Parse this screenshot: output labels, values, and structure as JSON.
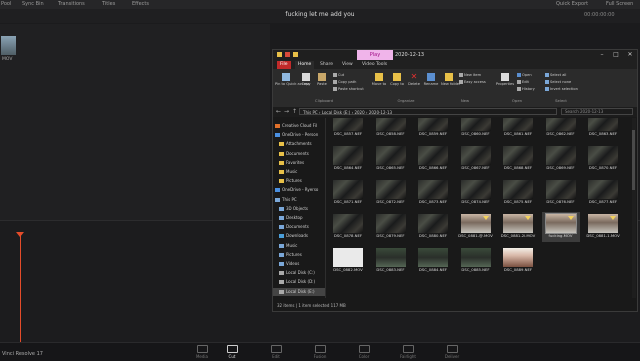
{
  "resolve": {
    "topbar": [
      "Pool",
      "Sync Bin",
      "Transitions",
      "Titles",
      "Effects"
    ],
    "quick_export": "Quick Export",
    "fullscreen": "Full Screen",
    "title": "fucking let me add you",
    "clip_label": "MOV",
    "version": "Vinci Resolve 17",
    "pages": [
      "Media",
      "Cut",
      "Edit",
      "Fusion",
      "Color",
      "Fairlight",
      "Deliver"
    ],
    "active_page": "Cut"
  },
  "explorer": {
    "play_tab": "Play",
    "title": "2020-12-13",
    "window_buttons": [
      "–",
      "□",
      "✕"
    ],
    "menu_tabs": [
      "File",
      "Home",
      "Share",
      "View",
      "Video Tools"
    ],
    "ribbon": {
      "pin": "Pin to Quick access",
      "copy": "Copy",
      "paste": "Paste",
      "cut": "Cut",
      "copy_path": "Copy path",
      "paste_shortcut": "Paste shortcut",
      "move_to": "Move to",
      "copy_to": "Copy to",
      "delete": "Delete",
      "rename": "Rename",
      "new_folder": "New folder",
      "new_item": "New item",
      "easy_access": "Easy access",
      "properties": "Properties",
      "open": "Open",
      "edit": "Edit",
      "history": "History",
      "select_all": "Select all",
      "select_none": "Select none",
      "invert_selection": "Invert selection",
      "groups": [
        "Clipboard",
        "Organize",
        "New",
        "Open",
        "Select"
      ]
    },
    "breadcrumb": [
      "This PC",
      "Local Disk (E:)",
      "2020",
      "2020-12-13"
    ],
    "search_placeholder": "Search 2020-12-13",
    "nav_items": [
      "Creative Cloud Fil",
      "OneDrive - Person",
      "Attachments",
      "Documents",
      "Favorites",
      "Music",
      "Pictures",
      "OneDrive - Ryerso",
      "This PC",
      "3D Objects",
      "Desktop",
      "Documents",
      "Downloads",
      "Music",
      "Pictures",
      "Videos",
      "Local Disk (C:)",
      "Local Disk (D:)",
      "Local Disk (E:)"
    ],
    "files": [
      {
        "name": "DSC_0857.NEF",
        "kind": "nef"
      },
      {
        "name": "DSC_0858.NEF",
        "kind": "nef"
      },
      {
        "name": "DSC_0859.NEF",
        "kind": "nef"
      },
      {
        "name": "DSC_0860.NEF",
        "kind": "nef"
      },
      {
        "name": "DSC_0861.NEF",
        "kind": "nef"
      },
      {
        "name": "DSC_0862.NEF",
        "kind": "nef"
      },
      {
        "name": "DSC_0863.NEF",
        "kind": "nef"
      },
      {
        "name": "DSC_0864.NEF",
        "kind": "nef"
      },
      {
        "name": "DSC_0865.NEF",
        "kind": "nef"
      },
      {
        "name": "DSC_0866.NEF",
        "kind": "nef"
      },
      {
        "name": "DSC_0867.NEF",
        "kind": "nef"
      },
      {
        "name": "DSC_0868.NEF",
        "kind": "nef"
      },
      {
        "name": "DSC_0869.NEF",
        "kind": "nef"
      },
      {
        "name": "DSC_0870.NEF",
        "kind": "nef"
      },
      {
        "name": "DSC_0871.NEF",
        "kind": "nef"
      },
      {
        "name": "DSC_0872.NEF",
        "kind": "nef"
      },
      {
        "name": "DSC_0873.NEF",
        "kind": "nef"
      },
      {
        "name": "DSC_0874.NEF",
        "kind": "nef"
      },
      {
        "name": "DSC_0875.NEF",
        "kind": "nef"
      },
      {
        "name": "DSC_0876.NEF",
        "kind": "nef"
      },
      {
        "name": "DSC_0877.NEF",
        "kind": "nef"
      },
      {
        "name": "DSC_0878.NEF",
        "kind": "nef"
      },
      {
        "name": "DSC_0879.NEF",
        "kind": "nef"
      },
      {
        "name": "DSC_0880.NEF",
        "kind": "nef"
      },
      {
        "name": "DSC_0881-@.MOV",
        "kind": "mov"
      },
      {
        "name": "DSC_0881-2l.MOV",
        "kind": "mov"
      },
      {
        "name": "fucking.MOV",
        "kind": "mov",
        "selected": true
      },
      {
        "name": "DSC_0881-1.MOV",
        "kind": "mov"
      },
      {
        "name": "DSC_0882.MOV",
        "kind": "white"
      },
      {
        "name": "DSC_0883.NEF",
        "kind": "person"
      },
      {
        "name": "DSC_0884.NEF",
        "kind": "person"
      },
      {
        "name": "DSC_0885.NEF",
        "kind": "person"
      },
      {
        "name": "DSC_0889.NEF",
        "kind": "bright"
      }
    ],
    "status": "32 items   |   1 item selected  117 MB"
  }
}
